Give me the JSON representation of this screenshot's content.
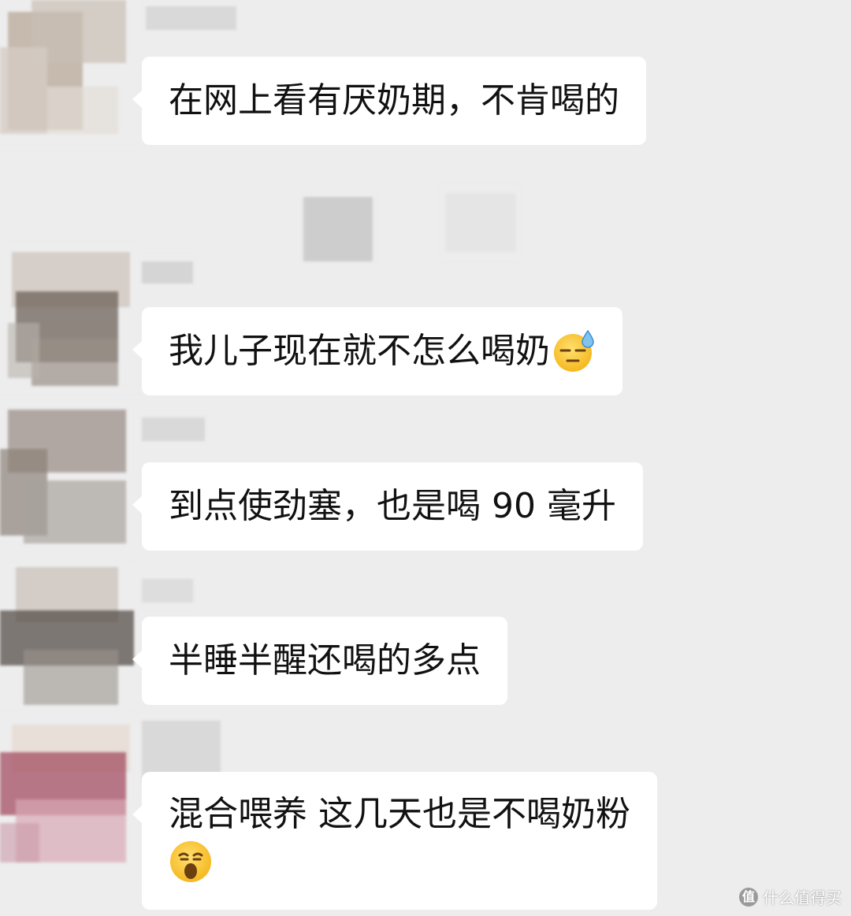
{
  "messages": [
    {
      "text": "在网上看有厌奶期，不肯喝的",
      "emoji": ""
    },
    {
      "text": "我儿子现在就不怎么喝奶",
      "emoji": "sweat-emoji"
    },
    {
      "text": "到点使劲塞，也是喝 90 毫升",
      "emoji": ""
    },
    {
      "text": "半睡半醒还喝的多点",
      "emoji": ""
    },
    {
      "text": "混合喂养 这几天也是不喝奶粉",
      "emoji": "sleeping-emoji"
    }
  ],
  "watermark": {
    "icon": "值",
    "text": "什么值得买"
  },
  "colors": {
    "background": "#ededed",
    "bubble": "#ffffff",
    "text": "#111111"
  }
}
